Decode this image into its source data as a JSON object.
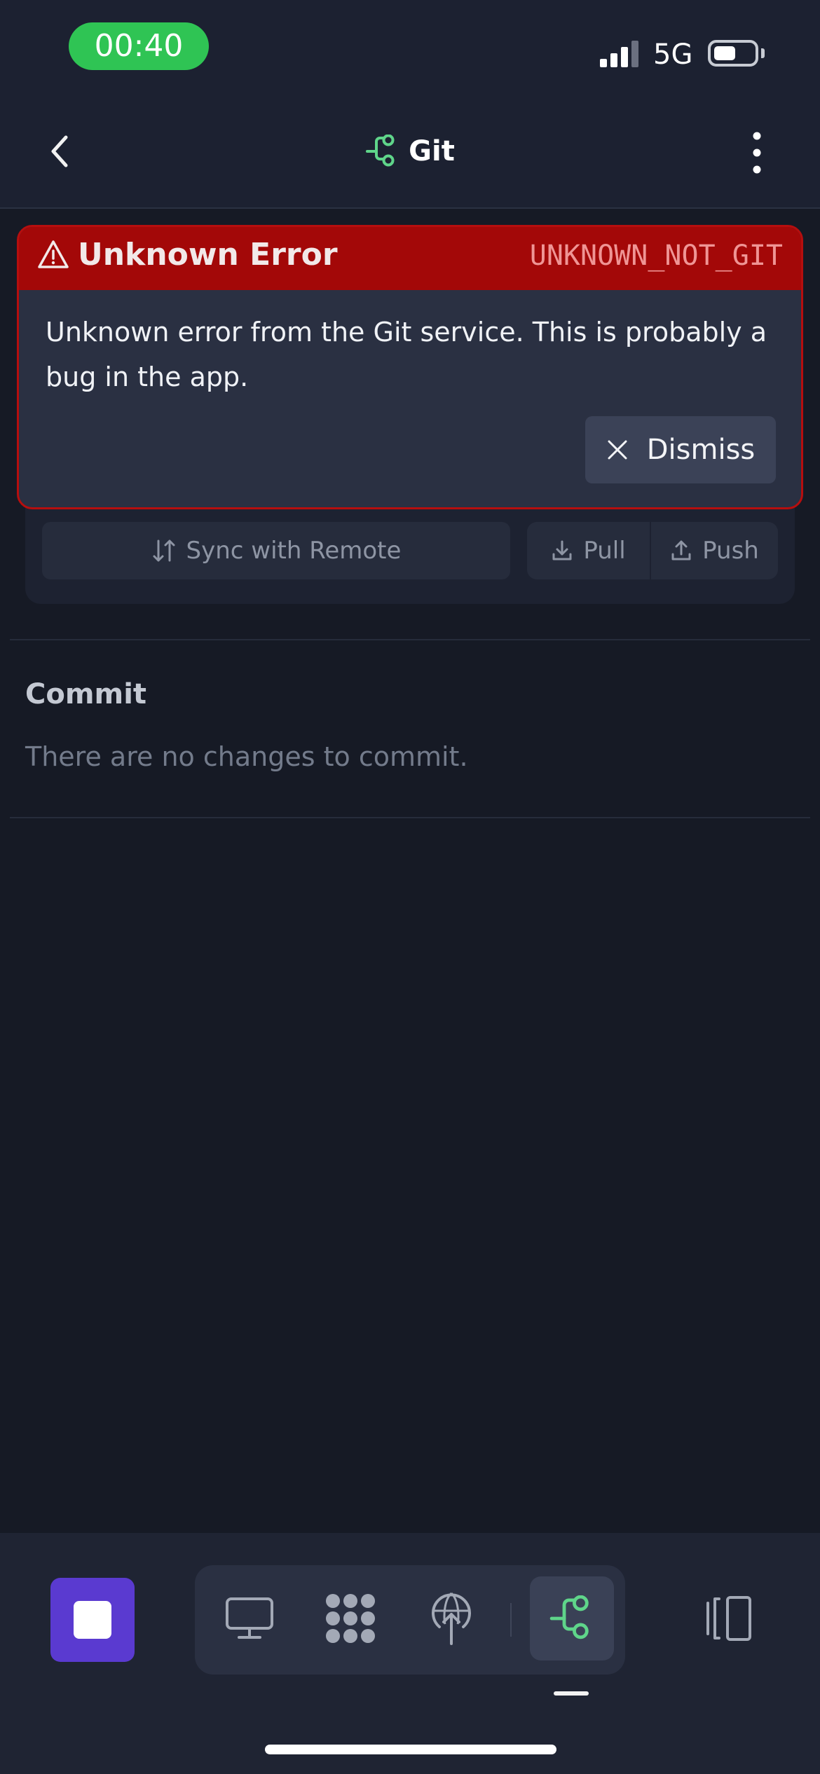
{
  "status_bar": {
    "time": "00:40",
    "network": "5G",
    "battery_level": 0.55
  },
  "header": {
    "title": "Git",
    "title_icon": "git-branch-icon",
    "back_icon": "chevron-left-icon",
    "more_icon": "more-vertical-icon"
  },
  "remote": {
    "sync_label": "Sync with Remote",
    "pull_label": "Pull",
    "push_label": "Push"
  },
  "commit": {
    "heading": "Commit",
    "empty_message": "There are no changes to commit."
  },
  "error_toast": {
    "title": "Unknown Error",
    "code": "UNKNOWN_NOT_GIT",
    "message": "Unknown error from the Git service. This is probably a bug in the app.",
    "dismiss_label": "Dismiss",
    "header_color": "#a30808",
    "border_color": "#b60e0e"
  },
  "tab_bar": {
    "stop_icon": "stop-icon",
    "tabs": [
      {
        "icon": "monitor-icon",
        "active": false
      },
      {
        "icon": "apps-icon",
        "active": false
      },
      {
        "icon": "deploy-icon",
        "active": false
      },
      {
        "icon": "git-branch-icon",
        "active": true
      }
    ],
    "panel_icon": "panel-toggle-icon"
  },
  "colors": {
    "accent_green": "#5fd58a",
    "stop_button": "#5a3ad0",
    "background": "#161a25"
  }
}
